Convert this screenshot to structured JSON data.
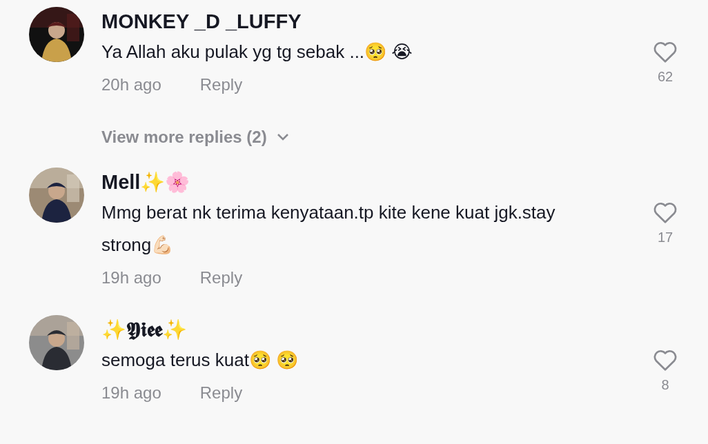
{
  "comments": [
    {
      "username": "MONKEY _D _LUFFY",
      "text": "Ya Allah aku pulak yg tg sebak ...🥺 😭",
      "time": "20h ago",
      "reply": "Reply",
      "likes": "62",
      "liked": false,
      "more_replies": "View more replies (2)"
    },
    {
      "username": "Mell✨🌸",
      "text": "Mmg berat nk terima kenyataan.tp kite kene kuat jgk.stay strong💪🏻",
      "time": "19h ago",
      "reply": "Reply",
      "likes": "17",
      "liked": false
    },
    {
      "username": "✨𝖄𝖎𝖊𝖊✨",
      "text": "semoga terus kuat🥺 🥺",
      "time": "19h ago",
      "reply": "Reply",
      "likes": "8",
      "liked": false
    }
  ]
}
